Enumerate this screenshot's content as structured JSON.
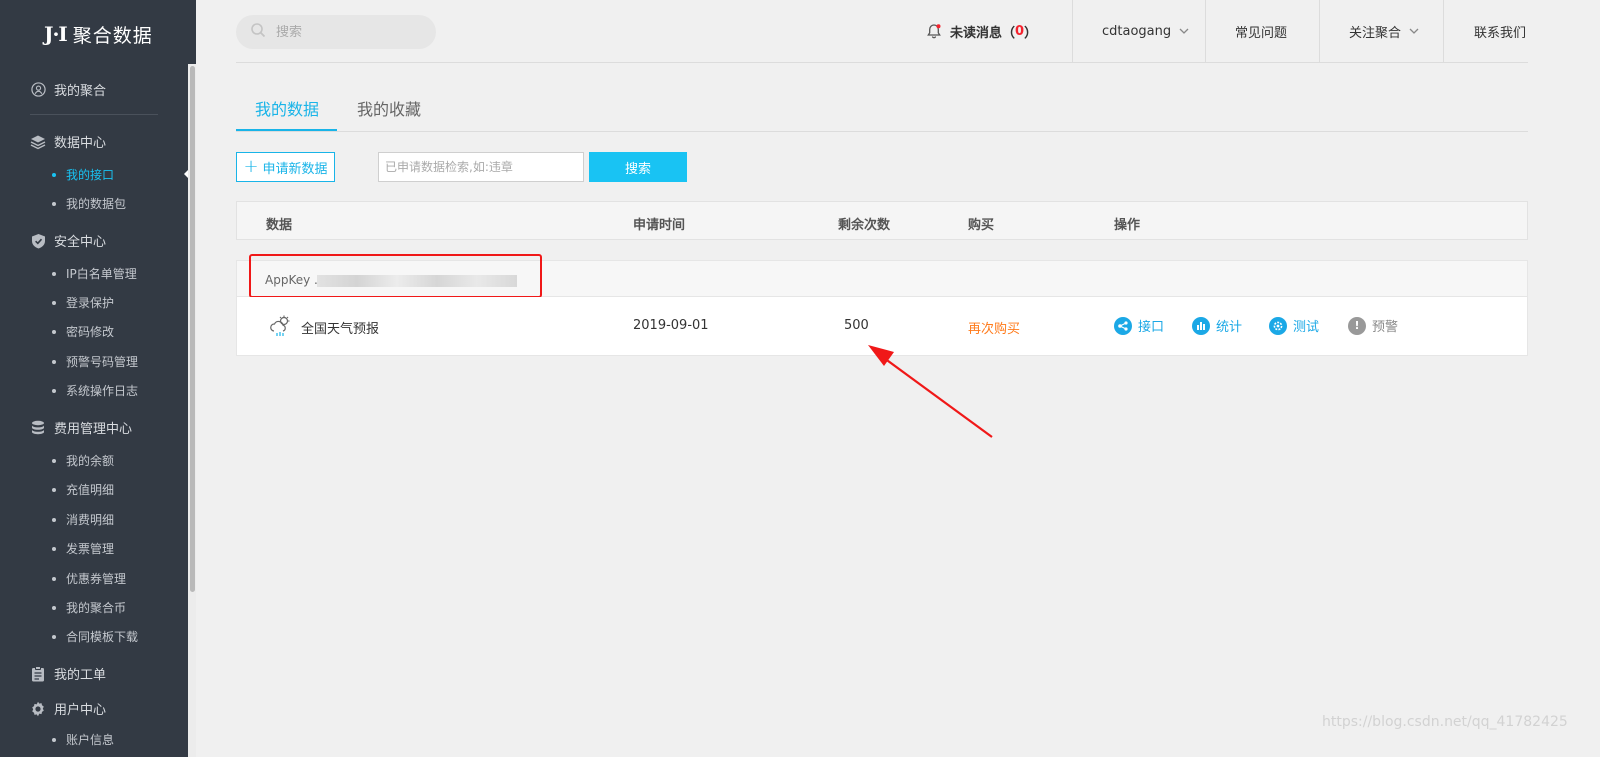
{
  "sidebar": {
    "logo_mark": "J·I",
    "logo_text": "聚合数据",
    "groups": [
      {
        "label": "我的聚合",
        "icon": "user-circle-icon"
      },
      {
        "label": "数据中心",
        "icon": "layers-icon"
      },
      {
        "label": "安全中心",
        "icon": "shield-icon"
      },
      {
        "label": "费用管理中心",
        "icon": "database-icon"
      },
      {
        "label": "我的工单",
        "icon": "clipboard-icon"
      },
      {
        "label": "用户中心",
        "icon": "gear-icon"
      }
    ],
    "data_center_items": [
      "我的接口",
      "我的数据包"
    ],
    "security_items": [
      "IP白名单管理",
      "登录保护",
      "密码修改",
      "预警号码管理",
      "系统操作日志"
    ],
    "billing_items": [
      "我的余额",
      "充值明细",
      "消费明细",
      "发票管理",
      "优惠券管理",
      "我的聚合币",
      "合同模板下载"
    ],
    "user_items": [
      "账户信息"
    ]
  },
  "header": {
    "search_placeholder": "搜索",
    "unread_label": "未读消息",
    "unread_open": "（",
    "unread_count": "0",
    "unread_close": "）",
    "username": "cdtaogang",
    "faq": "常见问题",
    "follow": "关注聚合",
    "contact": "联系我们"
  },
  "tabs": [
    "我的数据",
    "我的收藏"
  ],
  "actions": {
    "apply_label": "申请新数据",
    "query_placeholder": "已申请数据检索,如:违章",
    "search_label": "搜索"
  },
  "table": {
    "columns": [
      "数据",
      "申请时间",
      "剩余次数",
      "购买",
      "操作"
    ],
    "appkey_label": "AppKey .",
    "row": {
      "name": "全国天气预报",
      "date": "2019-09-01",
      "remaining": "500",
      "buy": "再次购买",
      "ops": [
        "接口",
        "统计",
        "测试",
        "预警"
      ]
    }
  },
  "watermark": "https://blog.csdn.net/qq_41782425",
  "colors": {
    "sidebar_bg": "#333a44",
    "accent": "#19c3f3",
    "rebuy": "#ff7a1a",
    "highlight": "#f01818"
  }
}
